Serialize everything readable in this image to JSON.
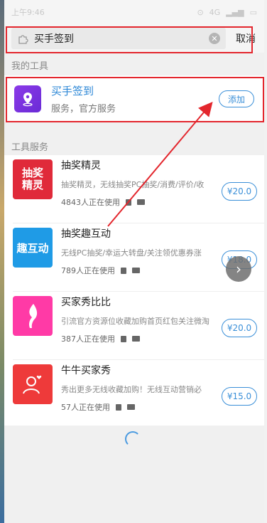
{
  "status_bar": {
    "time": "上午9:46",
    "network": "4G"
  },
  "search": {
    "query": "买手签到",
    "cancel_label": "取消"
  },
  "my_tools": {
    "section_label": "我的工具",
    "item": {
      "name": "买手签到",
      "description": "服务，官方服务",
      "action_label": "添加"
    }
  },
  "tool_services": {
    "section_label": "工具服务",
    "items": [
      {
        "name": "抽奖精灵",
        "description": "抽奖精灵，无线抽奖PC抽奖/消费/评价/收",
        "users": "4843人正在使用",
        "price": "¥20.0",
        "icon_text": "抽奖精灵",
        "icon_color": "#e02a3a"
      },
      {
        "name": "抽奖趣互动",
        "description": "无线PC抽奖/幸运大转盘/关注领优惠券涨",
        "users": "789人正在使用",
        "price": "¥18.0",
        "icon_text": "趣互动",
        "icon_color": "#1f9be6"
      },
      {
        "name": "买家秀比比",
        "description": "引流官方资源位收藏加购首页红包关注微淘",
        "users": "387人正在使用",
        "price": "¥20.0",
        "icon_text": "",
        "icon_color": "#ff3aa6"
      },
      {
        "name": "牛牛买家秀",
        "description": "秀出更多无线收藏加购！无线互动营销必",
        "users": "57人正在使用",
        "price": "¥15.0",
        "icon_text": "",
        "icon_color": "#ee3a3a"
      }
    ]
  },
  "colors": {
    "accent": "#3a8fd8",
    "highlight_red": "#e3262d"
  }
}
